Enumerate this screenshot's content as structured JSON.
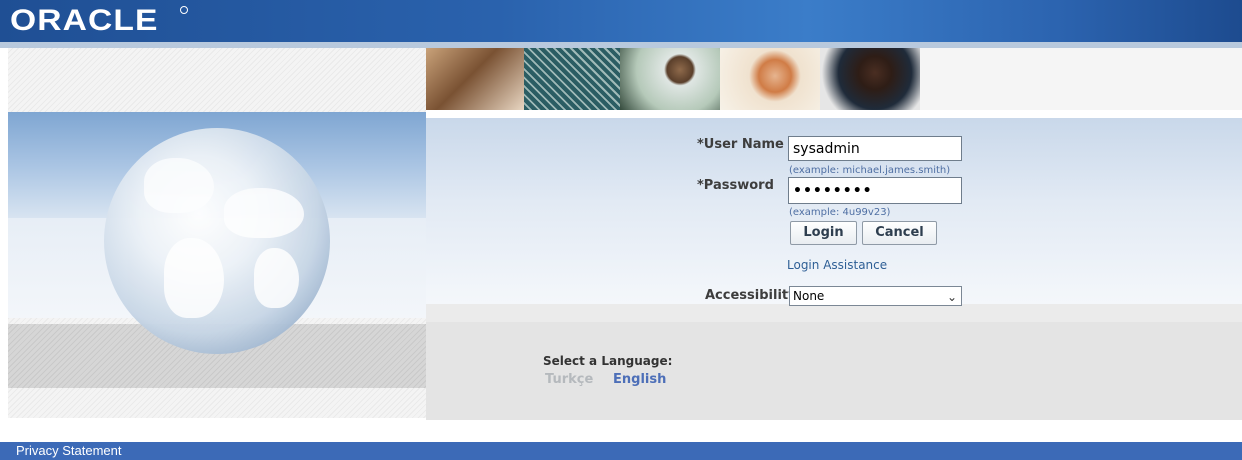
{
  "brand": {
    "logo_text": "ORACLE"
  },
  "login_form": {
    "username_label": "*User Name",
    "username_value": "sysadmin",
    "username_hint": "(example: michael.james.smith)",
    "password_label": "*Password",
    "password_value": "••••••••",
    "password_hint": "(example: 4u99v23)",
    "login_button": "Login",
    "cancel_button": "Cancel",
    "assistance_link": "Login Assistance",
    "accessibility_label": "Accessibility",
    "accessibility_value": "None"
  },
  "language": {
    "label": "Select a Language:",
    "options": [
      {
        "label": "Turkçe",
        "color": "#b5b9bd"
      },
      {
        "label": "English",
        "color": "#4d6fb8"
      }
    ]
  },
  "footer": {
    "privacy_link": "Privacy Statement"
  },
  "colors": {
    "header_blue": "#2a62ad",
    "footer_blue": "#3c6ab7",
    "link_blue": "#2e5f95"
  }
}
